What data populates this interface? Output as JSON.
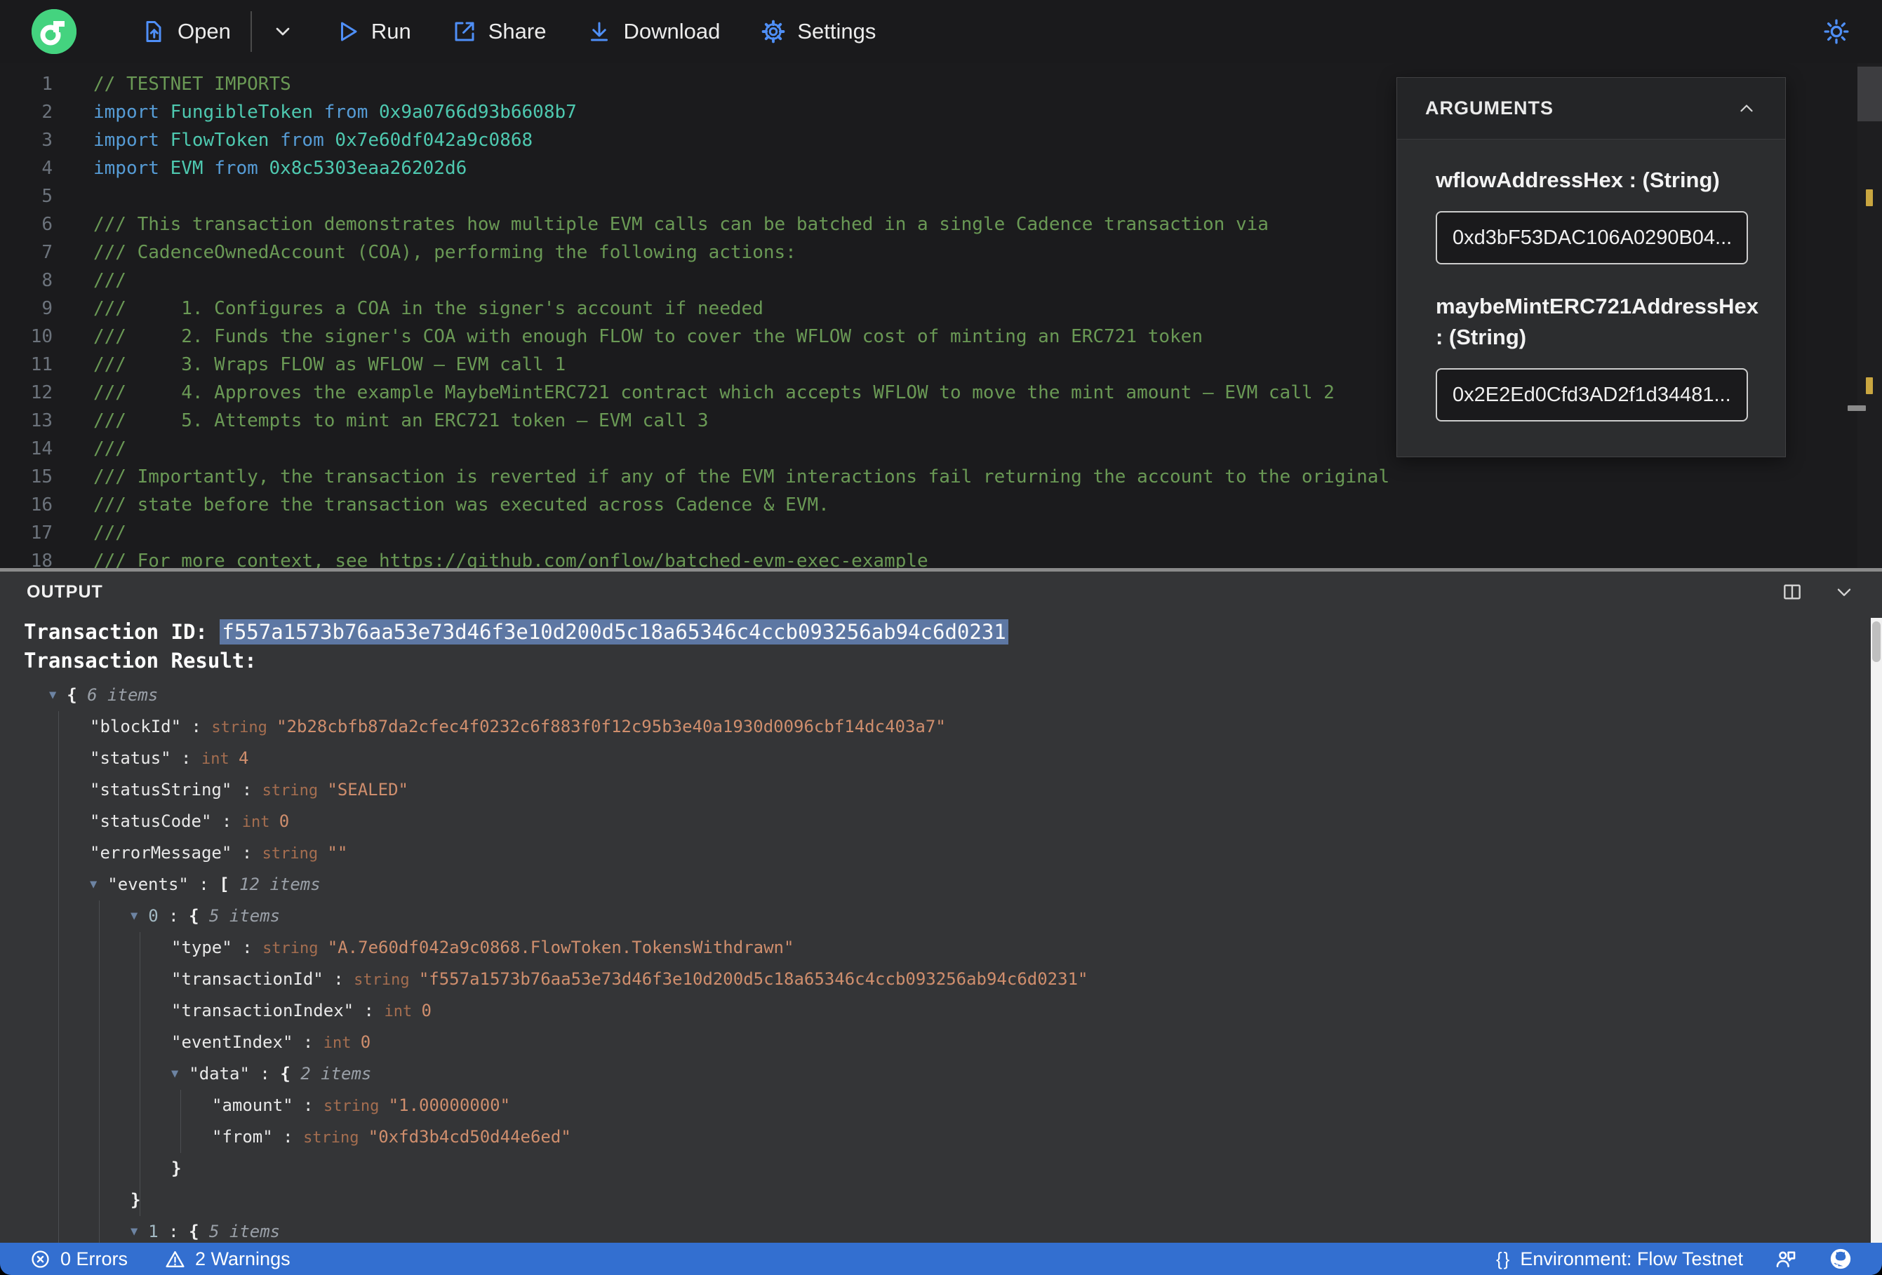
{
  "toolbar": {
    "open": "Open",
    "run": "Run",
    "share": "Share",
    "download": "Download",
    "settings": "Settings"
  },
  "arguments_panel": {
    "title": "ARGUMENTS",
    "fields": [
      {
        "label": "wflowAddressHex : (String)",
        "value": "0xd3bF53DAC106A0290B04..."
      },
      {
        "label": "maybeMintERC721AddressHex : (String)",
        "value": "0x2E2Ed0Cfd3AD2f1d34481..."
      }
    ]
  },
  "editor": {
    "lines": [
      {
        "n": "1",
        "parts": [
          {
            "t": "// TESTNET IMPORTS",
            "c": "c"
          }
        ]
      },
      {
        "n": "2",
        "parts": [
          {
            "t": "import ",
            "c": "k"
          },
          {
            "t": "FungibleToken ",
            "c": "t"
          },
          {
            "t": "from ",
            "c": "k"
          },
          {
            "t": "0x9a0766d93b6608b7",
            "c": "t"
          }
        ]
      },
      {
        "n": "3",
        "parts": [
          {
            "t": "import ",
            "c": "k"
          },
          {
            "t": "FlowToken ",
            "c": "t"
          },
          {
            "t": "from ",
            "c": "k"
          },
          {
            "t": "0x7e60df042a9c0868",
            "c": "t"
          }
        ]
      },
      {
        "n": "4",
        "parts": [
          {
            "t": "import ",
            "c": "k"
          },
          {
            "t": "EVM ",
            "c": "t"
          },
          {
            "t": "from ",
            "c": "k"
          },
          {
            "t": "0x8c5303eaa26202d6",
            "c": "t"
          }
        ]
      },
      {
        "n": "5",
        "parts": []
      },
      {
        "n": "6",
        "parts": [
          {
            "t": "/// This transaction demonstrates how multiple EVM calls can be batched in a single Cadence transaction via",
            "c": "c"
          }
        ]
      },
      {
        "n": "7",
        "parts": [
          {
            "t": "/// CadenceOwnedAccount (COA), performing the following actions:",
            "c": "c"
          }
        ]
      },
      {
        "n": "8",
        "parts": [
          {
            "t": "///",
            "c": "c"
          }
        ]
      },
      {
        "n": "9",
        "parts": [
          {
            "t": "///     1. Configures a COA in the signer's account if needed",
            "c": "c"
          }
        ]
      },
      {
        "n": "10",
        "parts": [
          {
            "t": "///     2. Funds the signer's COA with enough FLOW to cover the WFLOW cost of minting an ERC721 token",
            "c": "c"
          }
        ]
      },
      {
        "n": "11",
        "parts": [
          {
            "t": "///     3. Wraps FLOW as WFLOW – EVM call 1",
            "c": "c"
          }
        ]
      },
      {
        "n": "12",
        "parts": [
          {
            "t": "///     4. Approves the example MaybeMintERC721 contract which accepts WFLOW to move the mint amount – EVM call 2",
            "c": "c"
          }
        ]
      },
      {
        "n": "13",
        "parts": [
          {
            "t": "///     5. Attempts to mint an ERC721 token – EVM call 3",
            "c": "c"
          }
        ]
      },
      {
        "n": "14",
        "parts": [
          {
            "t": "///",
            "c": "c"
          }
        ]
      },
      {
        "n": "15",
        "parts": [
          {
            "t": "/// Importantly, the transaction is reverted if any of the EVM interactions fail returning the account to the original",
            "c": "c"
          }
        ]
      },
      {
        "n": "16",
        "parts": [
          {
            "t": "/// state before the transaction was executed across Cadence & EVM.",
            "c": "c"
          }
        ]
      },
      {
        "n": "17",
        "parts": [
          {
            "t": "///",
            "c": "c"
          }
        ]
      },
      {
        "n": "18",
        "parts": [
          {
            "t": "/// For more context, see ",
            "c": "c"
          },
          {
            "t": "https://github.com/onflow/batched-evm-exec-example",
            "c": "l"
          }
        ]
      }
    ]
  },
  "output": {
    "title": "OUTPUT",
    "transaction_id_label": "Transaction ID: ",
    "transaction_id": "f557a1573b76aa53e73d46f3e10d200d5c18a65346c4ccb093256ab94c6d0231",
    "transaction_result_label": "Transaction Result:",
    "tree": [
      {
        "ind": 0,
        "tri": true,
        "open": "{",
        "items": "6 items"
      },
      {
        "ind": 1,
        "key": "\"blockId\"",
        "type": "string",
        "val": "\"2b28cbfb87da2cfec4f0232c6f883f0f12c95b3e40a1930d0096cbf14dc403a7\""
      },
      {
        "ind": 1,
        "key": "\"status\"",
        "type": "int",
        "val": "4"
      },
      {
        "ind": 1,
        "key": "\"statusString\"",
        "type": "string",
        "val": "\"SEALED\""
      },
      {
        "ind": 1,
        "key": "\"statusCode\"",
        "type": "int",
        "val": "0"
      },
      {
        "ind": 1,
        "key": "\"errorMessage\"",
        "type": "string",
        "val": "\"\""
      },
      {
        "ind": 1,
        "tri": true,
        "key": "\"events\"",
        "open": "[",
        "items": "12 items"
      },
      {
        "ind": 2,
        "tri": true,
        "key": "0",
        "idx": true,
        "open": "{",
        "items": "5 items"
      },
      {
        "ind": 3,
        "key": "\"type\"",
        "type": "string",
        "val": "\"A.7e60df042a9c0868.FlowToken.TokensWithdrawn\""
      },
      {
        "ind": 3,
        "key": "\"transactionId\"",
        "type": "string",
        "val": "\"f557a1573b76aa53e73d46f3e10d200d5c18a65346c4ccb093256ab94c6d0231\""
      },
      {
        "ind": 3,
        "key": "\"transactionIndex\"",
        "type": "int",
        "val": "0"
      },
      {
        "ind": 3,
        "key": "\"eventIndex\"",
        "type": "int",
        "val": "0"
      },
      {
        "ind": 3,
        "tri": true,
        "key": "\"data\"",
        "open": "{",
        "items": "2 items"
      },
      {
        "ind": 4,
        "key": "\"amount\"",
        "type": "string",
        "val": "\"1.00000000\""
      },
      {
        "ind": 4,
        "key": "\"from\"",
        "type": "string",
        "val": "\"0xfd3b4cd50d44e6ed\""
      },
      {
        "ind": 3,
        "close": "}"
      },
      {
        "ind": 2,
        "close": "}"
      },
      {
        "ind": 2,
        "tri": true,
        "key": "1",
        "idx": true,
        "open": "{",
        "items": "5 items"
      }
    ]
  },
  "statusbar": {
    "errors": "0 Errors",
    "warnings": "2 Warnings",
    "braces_icon": "{}",
    "environment": "Environment: Flow Testnet"
  },
  "colors": {
    "accent_blue": "#4f8ff7",
    "flow_green": "#44d37f",
    "statusbar_blue": "#336fd0",
    "selection_blue": "#5d77a3",
    "warning_mark": "#c9a640",
    "string_value": "#cf8e6d",
    "comment_green": "#6a9955"
  }
}
